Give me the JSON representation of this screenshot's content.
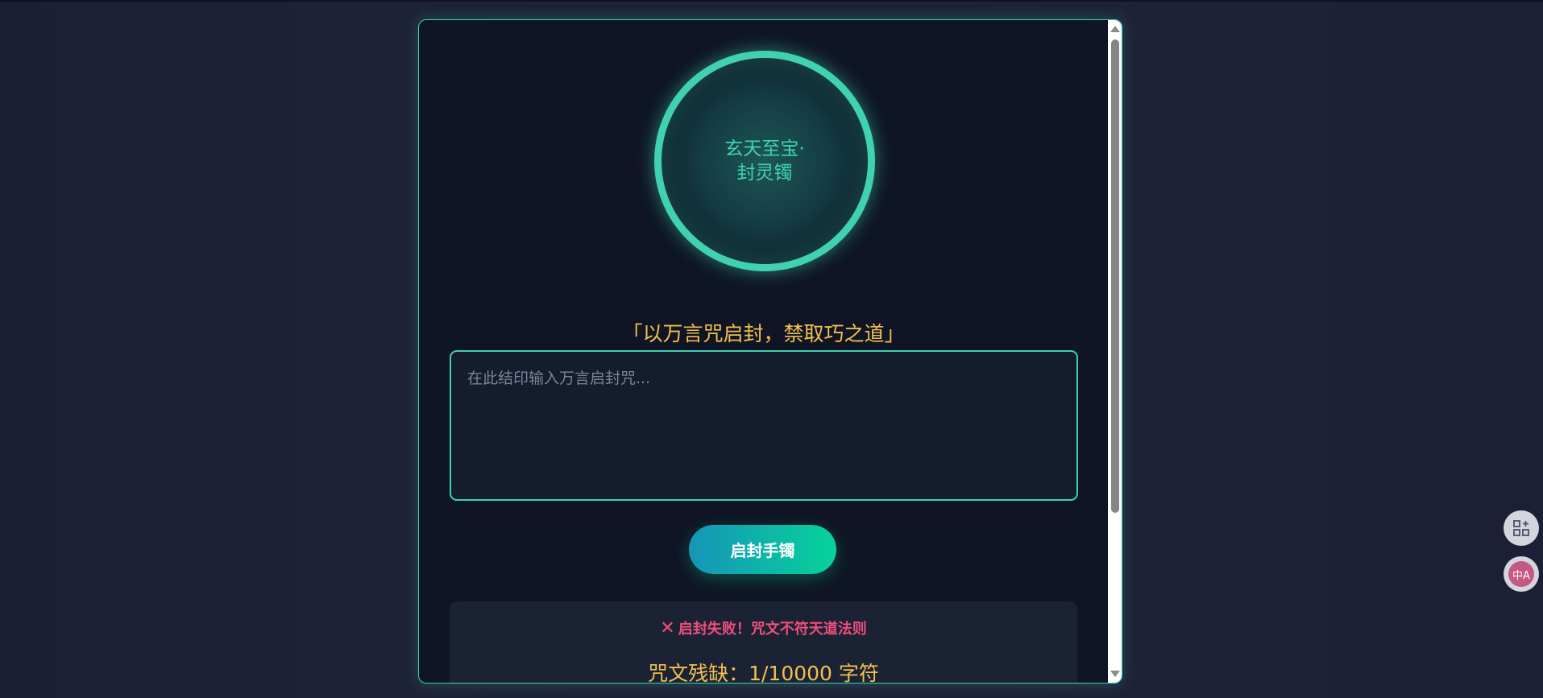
{
  "artifact": {
    "ring_text": "玄天至宝·\n封灵镯",
    "subtitle": "「以万言咒启封，禁取巧之道」",
    "input": {
      "value": "",
      "placeholder": "在此结印输入万言启封咒..."
    },
    "submit_label": "启封手镯",
    "result": {
      "error_icon": "✕",
      "error_text": "启封失败！咒文不符天道法则",
      "count_text": "咒文残缺：1/10000 字符"
    }
  },
  "floating": {
    "apps_icon": "apps-add-icon",
    "translate_label": "中A",
    "translate_icon": "translate-icon"
  },
  "colors": {
    "accent": "#3fd1b0",
    "gold": "#f3c04f",
    "error": "#ef4f7a",
    "panel_bg": "#0f1524"
  }
}
